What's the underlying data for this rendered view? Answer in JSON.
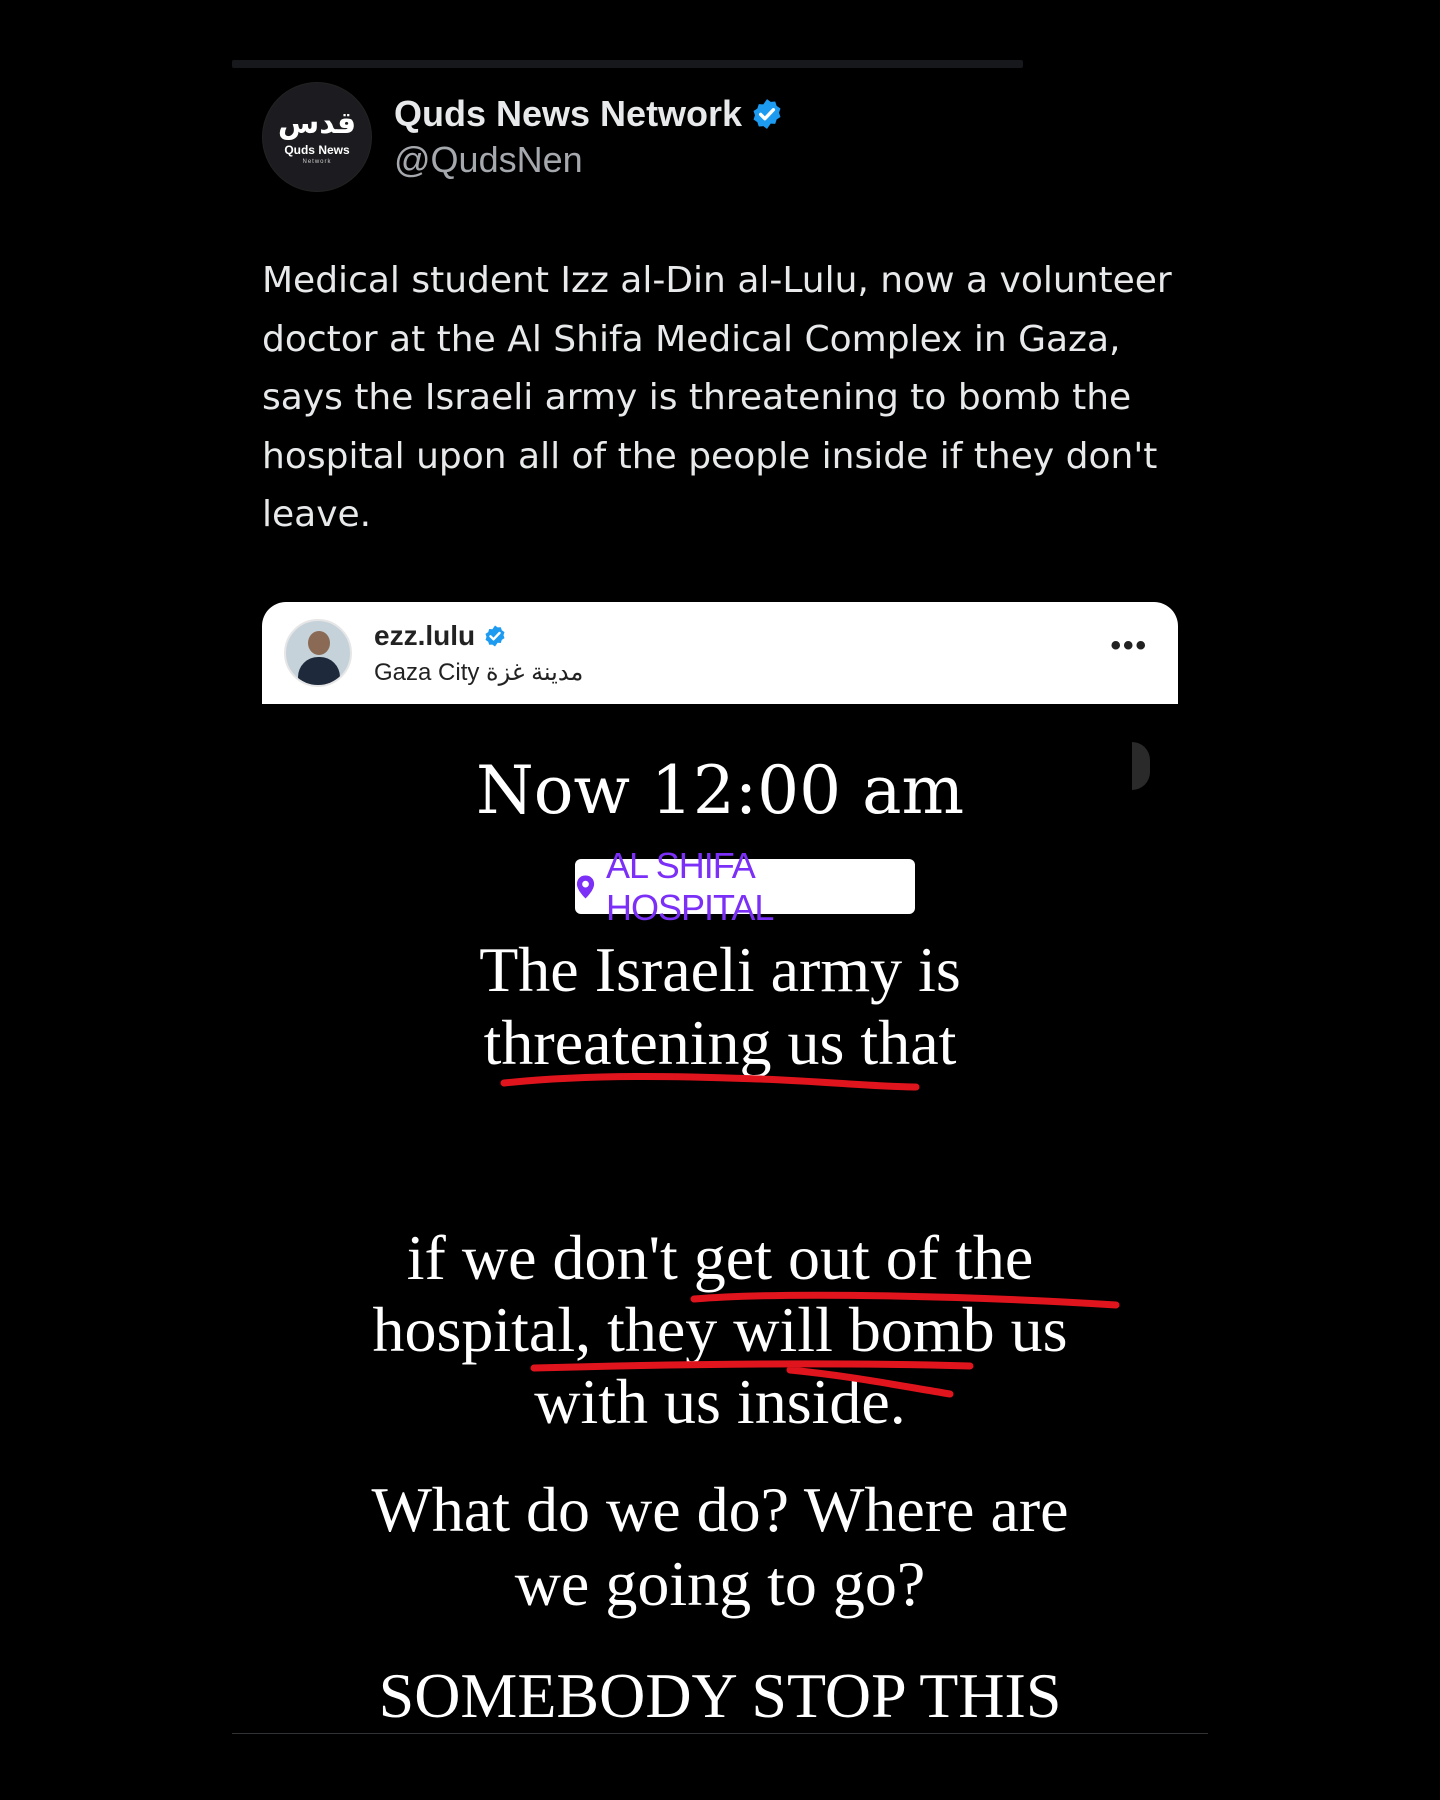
{
  "tweet": {
    "display_name": "Quds News Network",
    "handle": "@QudsNen",
    "avatar": {
      "logo_ar": "قدس",
      "logo_en": "Quds News",
      "logo_sub": "Network"
    },
    "text": "Medical student Izz al-Din al-Lulu, now a volunteer doctor at the Al Shifa Medical Complex in Gaza, says the Israeli army is threatening to bomb the hospital upon all of the people inside if they don't leave.",
    "colors": {
      "verified": "#1d9bf0",
      "background": "#000000",
      "text": "#e7e9ea",
      "handle": "#a5a9ad"
    }
  },
  "story": {
    "username": "ezz.lulu",
    "location": "Gaza City مدينة غزة",
    "more_icon": "more-horizontal-icon",
    "time": "Now 12:00 am",
    "location_sticker": "AL SHIFA HOSPITAL",
    "lines": [
      "The Israeli army is",
      "threatening us that",
      "if we don't get out of the",
      "hospital, they will bomb us",
      "with us inside.",
      "What do we do? Where are",
      "we going to go?",
      "SOMEBODY STOP THIS"
    ],
    "colors": {
      "sticker_text": "#7b2ff7",
      "underline": "#e0141c"
    }
  }
}
